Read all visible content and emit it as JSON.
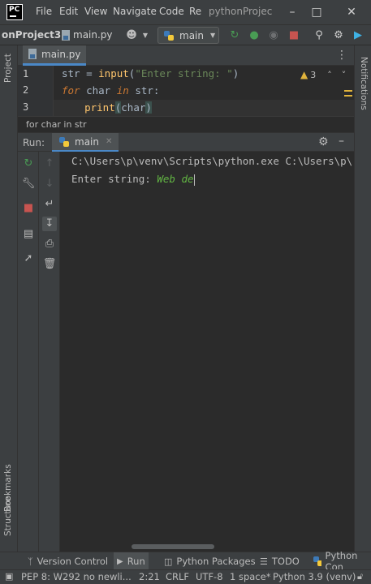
{
  "titlebar": {
    "menu": [
      "File",
      "Edit",
      "View",
      "Navigate",
      "Code",
      "Re"
    ],
    "project_title": "pythonProjec"
  },
  "navbar": {
    "project": "onProject3",
    "file": "main.py",
    "run_config": "main"
  },
  "left_strip": {
    "project": "Project",
    "bookmarks": "Bookmarks",
    "structure": "Structure"
  },
  "right_strip": {
    "notifications": "Notifications"
  },
  "editor_tab": {
    "label": "main.py"
  },
  "editor": {
    "line_numbers": [
      "1",
      "2",
      "3"
    ],
    "line1": {
      "var": "str",
      "eq": " = ",
      "fn": "input",
      "lp": "(",
      "s": "\"Enter string: \"",
      "rp": ")"
    },
    "line2": {
      "kw1": "for",
      "a": " char ",
      "kw2": "in",
      "b": " str",
      "c": ":"
    },
    "line3": {
      "indent": "    ",
      "fn": "print",
      "lp": "(",
      "arg": "char",
      "rp": ")"
    },
    "warning_count": "3"
  },
  "breadcrumb": "for char in str",
  "run_panel": {
    "label": "Run:",
    "tab": "main",
    "console": {
      "line1": "C:\\Users\\p\\venv\\Scripts\\python.exe C:\\Users\\p\\",
      "line2_prompt": "Enter string: ",
      "line2_input": "Web de"
    }
  },
  "bottom_tools": [
    "Version Control",
    "Run",
    "Python Packages",
    "TODO",
    "Python Con"
  ],
  "status": {
    "message": "PEP 8: W292 no newli...",
    "position": "2:21",
    "line_sep": "CRLF",
    "encoding": "UTF-8",
    "indent": "1 space*",
    "interpreter": "Python 3.9 (venv)"
  },
  "colors": {
    "accent": "#4a88c7",
    "keyword": "#cc7832",
    "function": "#ffc66d",
    "string": "#6a8759",
    "run_green": "#499c54",
    "stop_red": "#c75450"
  }
}
